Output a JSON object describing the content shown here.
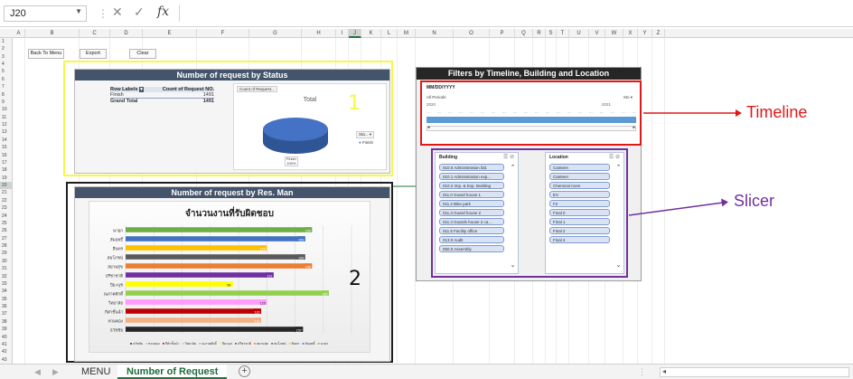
{
  "formula_bar": {
    "name_box": "J20",
    "fx": "fx",
    "cancel": "✕",
    "enter": "✓",
    "value": ""
  },
  "columns": [
    "A",
    "B",
    "C",
    "D",
    "E",
    "F",
    "G",
    "H",
    "I",
    "J",
    "K",
    "L",
    "M",
    "N",
    "O",
    "P",
    "Q",
    "R",
    "S",
    "T",
    "U",
    "V",
    "W",
    "X",
    "Y",
    "Z"
  ],
  "rows": [
    "1",
    "2",
    "3",
    "4",
    "5",
    "6",
    "7",
    "8",
    "9",
    "10",
    "11",
    "12",
    "13",
    "14",
    "15",
    "16",
    "17",
    "18",
    "19",
    "20",
    "21",
    "22",
    "23",
    "24",
    "25",
    "26",
    "27",
    "28",
    "29",
    "30",
    "31",
    "32",
    "33",
    "34",
    "35",
    "36",
    "37",
    "38",
    "39",
    "40",
    "41",
    "42",
    "43"
  ],
  "selected_column": "J",
  "selected_row": "20",
  "buttons": {
    "back": "Back To Menu",
    "export": "Export",
    "clear": "Clear"
  },
  "status_panel": {
    "title": "Number of request by Status",
    "label": "1",
    "pivot": {
      "headers": [
        "Row Labels",
        "Count of Request NO."
      ],
      "rows": [
        {
          "label": "Finish",
          "value": "1491"
        }
      ],
      "grand_total": {
        "label": "Grand Total",
        "value": "1491"
      }
    },
    "pie": {
      "field_button": "Count of Request...",
      "title": "Total",
      "slice_label_line1": "Finish",
      "slice_label_line2": "100%",
      "legend_button": "Sta...",
      "legend_item": "Finish",
      "color": "#4472c4"
    }
  },
  "man_panel": {
    "title": "Number of request by Res. Man",
    "label": "2",
    "chart_data": {
      "type": "bar",
      "orientation": "horizontal",
      "title": "จำนวนงานที่รับผิดชอบ",
      "categories": [
        "นายก",
        "สัมฤทธิ์",
        "สินทร",
        "สมโภชน์",
        "สยามสุข",
        "ปรีชาชาติ",
        "ปิยะนุช",
        "ณภาคศักดิ์",
        "วิทยาลัย",
        "กีฬาชั้นนำ",
        "ทวนทอง",
        "ธวัชชัย"
      ],
      "values": [
        165,
        159,
        125,
        159,
        165,
        131,
        95,
        180,
        125,
        120,
        120,
        157
      ],
      "value_labels": [
        "165",
        "159",
        "125",
        "159",
        "165",
        "131",
        "95",
        "180",
        "125",
        "120",
        "120",
        "157"
      ],
      "colors": [
        "#70ad47",
        "#4472c4",
        "#ffc000",
        "#5a5a5a",
        "#ed7d31",
        "#7030a0",
        "#ffff00",
        "#92d050",
        "#ff99ff",
        "#c00000",
        "#f4b183",
        "#262626"
      ],
      "legend": [
        "ธวัชชัย",
        "ทวนทอง",
        "กีฬาชั้นนำ",
        "วิทยาลัย",
        "ณภาคศักดิ์",
        "ปิยะนุช",
        "ปรีชาชาติ",
        "สยามสุข",
        "สมโภชน์",
        "สินทร",
        "สัมฤทธิ์",
        "นายก"
      ],
      "xlim": [
        0,
        200
      ],
      "grid": true,
      "legend_position": "bottom"
    }
  },
  "filters": {
    "title": "Filters by Timeline, Building and Location",
    "timeline": {
      "field": "MM/DD/YYYY",
      "range_label": "All Periods",
      "period_button": "Mo",
      "years": [
        "2020",
        "2021"
      ],
      "months": [
        "...",
        "...",
        "...",
        "...",
        "...",
        "...",
        "...",
        "...",
        "...",
        "...",
        "...",
        "...",
        "...",
        "...",
        "...",
        "...",
        "...",
        "...",
        "...",
        "..."
      ]
    },
    "building": {
      "header": "Building",
      "items": [
        "010.0 Administration bld.",
        "010.1 Administration exp...",
        "010.2 Imp. & Exp. Building",
        "011.0 Guard house 1",
        "011.2 Bike park",
        "011.3 Guard house 2",
        "011.4 Guards house 2 ca...",
        "011.5 Facility office",
        "013.0 Audit",
        "050.0 Assembly"
      ]
    },
    "location": {
      "header": "Location",
      "items": [
        "Canteen",
        "Canteen",
        "Chemical room",
        "EV",
        "F2",
        "Final 0",
        "Final 1",
        "Final 2",
        "Final 4"
      ]
    }
  },
  "callouts": {
    "timeline": "Timeline",
    "slicer": "Slicer",
    "timeline_color": "#e01818",
    "slicer_color": "#7030a0"
  },
  "tabs": {
    "items": [
      "MENU",
      "Number of Request"
    ],
    "active": "Number of Request",
    "add": "+"
  }
}
